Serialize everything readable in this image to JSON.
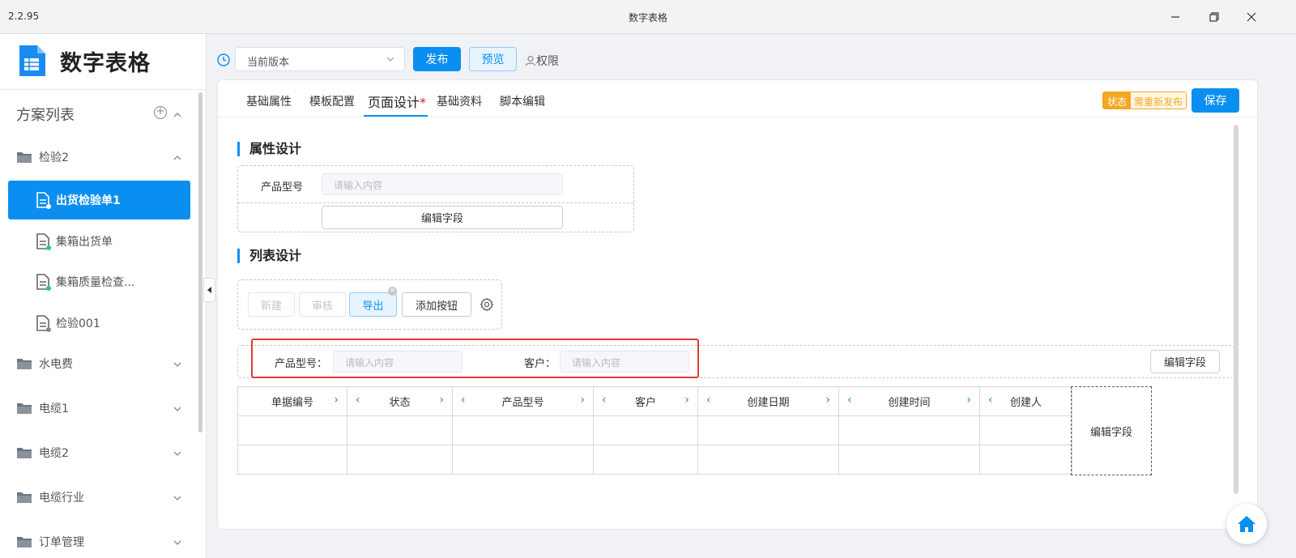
{
  "window": {
    "version": "2.2.95",
    "title": "数字表格"
  },
  "app": {
    "name": "数字表格"
  },
  "sidebar": {
    "list_title": "方案列表",
    "groups": [
      {
        "label": "检验2",
        "expanded": true
      },
      {
        "label": "水电费"
      },
      {
        "label": "电缆1"
      },
      {
        "label": "电缆2"
      },
      {
        "label": "电缆行业"
      },
      {
        "label": "订单管理"
      }
    ],
    "items": [
      {
        "label": "出货检验单1",
        "active": true,
        "status_color": "#2ecc71"
      },
      {
        "label": "集箱出货单",
        "status_color": "#2ecc71"
      },
      {
        "label": "集箱质量检查...",
        "status_color": "#2ecc71"
      },
      {
        "label": "检验001",
        "status_color": "#888888"
      }
    ]
  },
  "toolbar": {
    "version_select": "当前版本",
    "publish": "发布",
    "preview": "预览",
    "permission": "权限"
  },
  "tabs": [
    {
      "label": "基础属性"
    },
    {
      "label": "模板配置"
    },
    {
      "label": "页面设计",
      "active": true,
      "modified_mark": "*"
    },
    {
      "label": "基础资料"
    },
    {
      "label": "脚本编辑"
    }
  ],
  "status": {
    "key": "状态",
    "value": "需重新发布"
  },
  "save": "保存",
  "attr_section": {
    "title": "属性设计",
    "field_label": "产品型号",
    "placeholder": "请输入内容",
    "edit_fields": "编辑字段"
  },
  "list_section": {
    "title": "列表设计",
    "buttons": [
      "新建",
      "审核",
      "导出",
      "添加按钮"
    ],
    "search": {
      "fields": [
        {
          "label": "产品型号：",
          "placeholder": "请输入内容"
        },
        {
          "label": "客户：",
          "placeholder": "请输入内容"
        }
      ],
      "edit_fields": "编辑字段"
    },
    "columns": [
      "单据编号",
      "状态",
      "产品型号",
      "客户",
      "创建日期",
      "创建时间",
      "创建人"
    ],
    "rows": [
      [
        "",
        "",
        "",
        "",
        "",
        "",
        ""
      ],
      [
        "",
        "",
        "",
        "",
        "",
        "",
        ""
      ]
    ],
    "edit_column": "编辑字段"
  },
  "colors": {
    "accent": "#0a8ff0",
    "warning": "#f5a623",
    "highlight": "#e53935"
  }
}
